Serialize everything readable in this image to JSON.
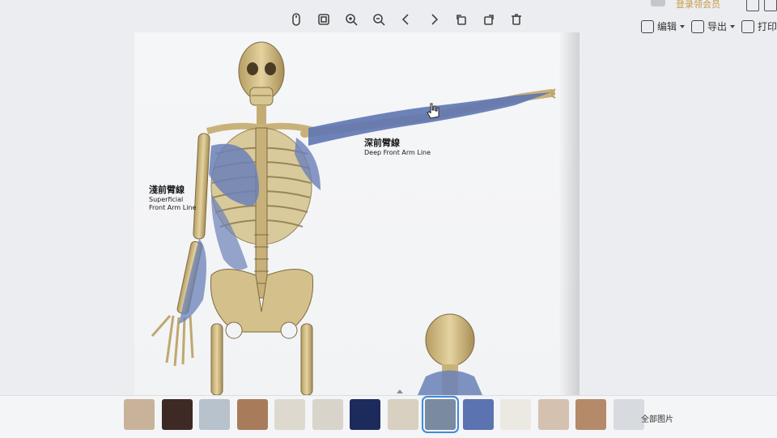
{
  "toolbar": {
    "icons": [
      "mouse-icon",
      "fit-screen-icon",
      "zoom-in-icon",
      "zoom-out-icon",
      "chevron-left-icon",
      "chevron-right-icon",
      "rotate-left-icon",
      "rotate-right-icon",
      "trash-icon"
    ]
  },
  "header": {
    "login_text": "登录领会员",
    "edit_label": "编辑",
    "export_label": "导出",
    "print_label": "打印"
  },
  "image": {
    "superficial_cn": "淺前臂線",
    "superficial_en_1": "Superficial",
    "superficial_en_2": "Front Arm Line",
    "deep_cn": "深前臂線",
    "deep_en": "Deep Front Arm Line"
  },
  "thumbnails": {
    "active_index": 8,
    "colors": [
      "#c9b29a",
      "#3d2a24",
      "#b8c2cd",
      "#a87c5a",
      "#ded9cf",
      "#d9d4cb",
      "#1d2b5c",
      "#d8d0c0",
      "#7a8aa0",
      "#5b73b0",
      "#ece9e3",
      "#d5c1b0",
      "#b48a6a",
      "#d7dadf"
    ],
    "all_images_label": "全部图片"
  },
  "colors": {
    "bone": "#d9c48f",
    "bone_shadow": "#a38a55",
    "muscle": "#6a80b8"
  }
}
